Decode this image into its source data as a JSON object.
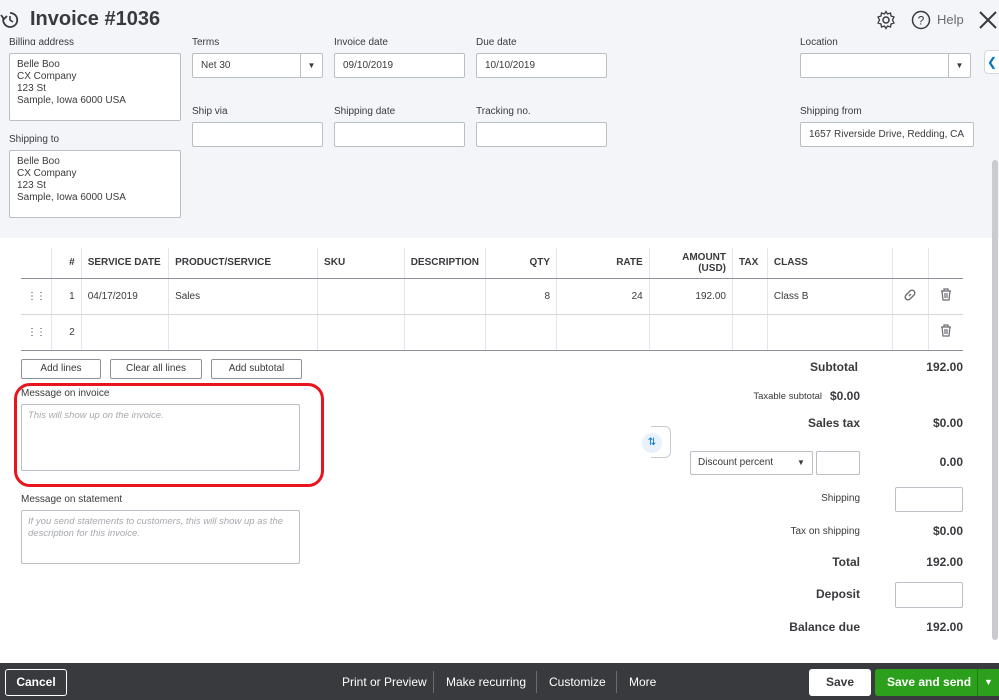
{
  "header": {
    "title": "Invoice #1036",
    "help_label": "Help"
  },
  "form": {
    "billing_label": "Billing address",
    "billing_lines": [
      "Belle Boo",
      "CX Company",
      "123 St",
      "Sample, Iowa  6000 USA"
    ],
    "shipping_to_label": "Shipping to",
    "shipping_lines": [
      "Belle Boo",
      "CX Company",
      "123 St",
      "Sample, Iowa  6000 USA"
    ],
    "terms_label": "Terms",
    "terms_value": "Net 30",
    "invoice_date_label": "Invoice date",
    "invoice_date": "09/10/2019",
    "due_date_label": "Due date",
    "due_date": "10/10/2019",
    "location_label": "Location",
    "location_value": "",
    "ship_via_label": "Ship via",
    "ship_via": "",
    "shipping_date_label": "Shipping date",
    "shipping_date": "",
    "tracking_label": "Tracking no.",
    "tracking": "",
    "shipping_from_label": "Shipping from",
    "shipping_from": "1657 Riverside Drive, Redding, CA"
  },
  "table": {
    "columns": [
      "#",
      "SERVICE DATE",
      "PRODUCT/SERVICE",
      "SKU",
      "DESCRIPTION",
      "QTY",
      "RATE",
      "AMOUNT (USD)",
      "TAX",
      "CLASS"
    ],
    "rows": [
      {
        "num": "1",
        "date": "04/17/2019",
        "product": "Sales",
        "sku": "",
        "desc": "",
        "qty": "8",
        "rate": "24",
        "amount": "192.00",
        "tax": "",
        "class": "Class B"
      },
      {
        "num": "2",
        "date": "",
        "product": "",
        "sku": "",
        "desc": "",
        "qty": "",
        "rate": "",
        "amount": "",
        "tax": "",
        "class": ""
      }
    ]
  },
  "buttons": {
    "add_lines": "Add lines",
    "clear_lines": "Clear all lines",
    "add_subtotal": "Add subtotal"
  },
  "messages": {
    "invoice_label": "Message on invoice",
    "invoice_placeholder": "This will show up on the invoice.",
    "statement_label": "Message on statement",
    "statement_placeholder": "If you send statements to customers, this will show up as the description for this invoice."
  },
  "totals": {
    "subtotal_label": "Subtotal",
    "subtotal": "192.00",
    "taxable_label": "Taxable subtotal",
    "taxable_value": "$0.00",
    "sales_tax_label": "Sales tax",
    "sales_tax": "$0.00",
    "discount_select": "Discount percent",
    "discount_value": "0.00",
    "shipping_label": "Shipping",
    "tax_on_shipping_label": "Tax on shipping",
    "tax_on_shipping": "$0.00",
    "total_label": "Total",
    "total": "192.00",
    "deposit_label": "Deposit",
    "balance_label": "Balance due",
    "balance": "192.00"
  },
  "footer": {
    "cancel": "Cancel",
    "print_preview": "Print or Preview",
    "make_recurring": "Make recurring",
    "customize": "Customize",
    "more": "More",
    "save": "Save",
    "save_send": "Save and send"
  },
  "colors": {
    "accent_green": "#2ca01c",
    "footer_bg": "#393a3d",
    "highlight_red": "#e8151d",
    "link_blue": "#0077c5"
  }
}
